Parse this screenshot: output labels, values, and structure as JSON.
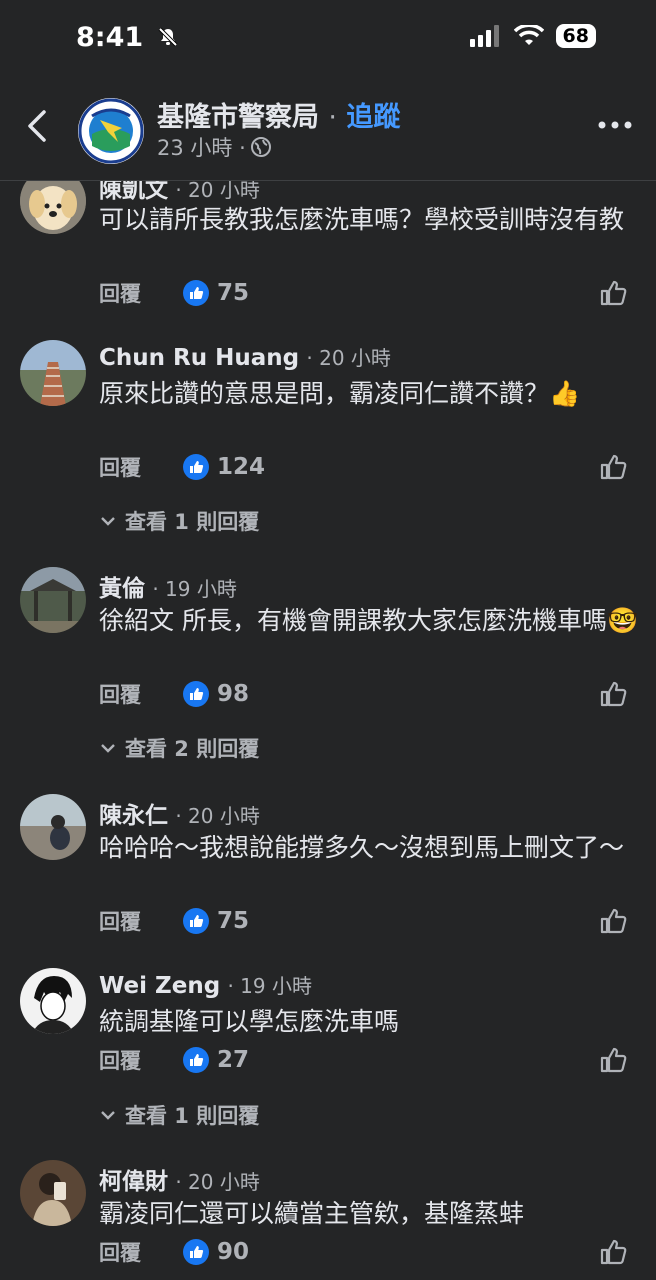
{
  "status": {
    "time": "8:41",
    "battery": "68"
  },
  "header": {
    "page_name": "基隆市警察局",
    "dot": "·",
    "follow": "追蹤",
    "time": "23 小時 ·"
  },
  "comments": [
    {
      "name": "陳凱文",
      "time": "· 20 小時",
      "text": "可以請所長教我怎麼洗車嗎？學校受訓時沒有教",
      "reply": "回覆",
      "likes": "75"
    },
    {
      "name": "Chun Ru Huang",
      "time": "· 20 小時",
      "text": "原來比讚的意思是問，霸凌同仁讚不讚？👍",
      "reply": "回覆",
      "likes": "124",
      "view_replies": "查看 1 則回覆"
    },
    {
      "name": "黃倫",
      "time": "· 19 小時",
      "text": "徐紹文 所長，有機會開課教大家怎麼洗機車嗎🤓",
      "reply": "回覆",
      "likes": "98",
      "view_replies": "查看 2 則回覆"
    },
    {
      "name": "陳永仁",
      "time": "· 20 小時",
      "text": "哈哈哈～我想說能撐多久～沒想到馬上刪文了～",
      "reply": "回覆",
      "likes": "75"
    },
    {
      "name": "Wei Zeng",
      "time": "· 19 小時",
      "text": "統調基隆可以學怎麼洗車嗎",
      "reply": "回覆",
      "likes": "27",
      "view_replies": "查看 1 則回覆"
    },
    {
      "name": "柯偉財",
      "time": "· 20 小時",
      "text": "霸凌同仁還可以續當主管欸，基隆蒸蚌",
      "reply": "回覆",
      "likes": "90"
    }
  ],
  "colors": {
    "background": "#242526",
    "like_blue": "#1877f2",
    "follow_blue": "#4599ff",
    "secondary_text": "#b0b3b8"
  },
  "icons": [
    "back-chevron-icon",
    "globe-icon",
    "more-icon",
    "thumbs-up-icon",
    "chevron-down-icon",
    "signal-icon",
    "wifi-icon",
    "silent-bell-icon"
  ]
}
